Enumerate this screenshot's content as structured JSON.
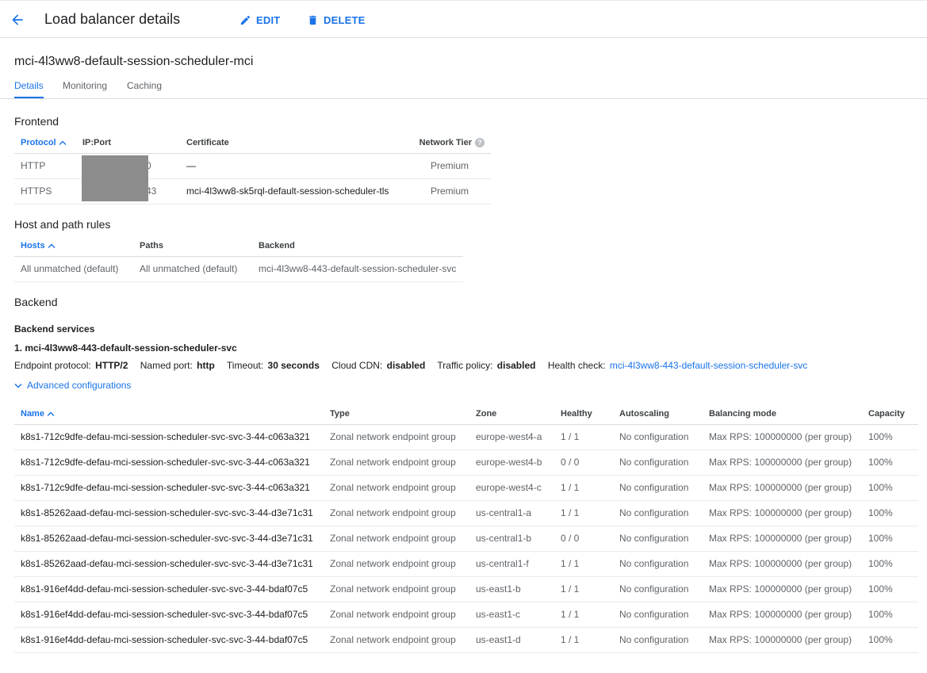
{
  "header": {
    "title": "Load balancer details",
    "edit_label": "EDIT",
    "delete_label": "DELETE",
    "accent": "#1a73e8"
  },
  "lb_name": "mci-4l3ww8-default-session-scheduler-mci",
  "tabs": [
    {
      "label": "Details",
      "active": true
    },
    {
      "label": "Monitoring",
      "active": false
    },
    {
      "label": "Caching",
      "active": false
    }
  ],
  "frontend": {
    "title": "Frontend",
    "headers": {
      "protocol": "Protocol",
      "ipport": "IP:Port",
      "certificate": "Certificate",
      "tier": "Network Tier"
    },
    "rows": [
      {
        "protocol": "HTTP",
        "port": ":80",
        "certificate": "—",
        "tier": "Premium"
      },
      {
        "protocol": "HTTPS",
        "port": ":443",
        "certificate": "mci-4l3ww8-sk5rql-default-session-scheduler-tls",
        "tier": "Premium"
      }
    ]
  },
  "host_rules": {
    "title": "Host and path rules",
    "headers": {
      "hosts": "Hosts",
      "paths": "Paths",
      "backend": "Backend"
    },
    "rows": [
      {
        "hosts": "All unmatched (default)",
        "paths": "All unmatched (default)",
        "backend": "mci-4l3ww8-443-default-session-scheduler-svc"
      }
    ]
  },
  "backend": {
    "title": "Backend",
    "services_title": "Backend services",
    "service_name": "1. mci-4l3ww8-443-default-session-scheduler-svc",
    "endpoint_label": "Endpoint protocol:",
    "endpoint_value": "HTTP/2",
    "port_label": "Named port:",
    "port_value": "http",
    "timeout_label": "Timeout:",
    "timeout_value": "30 seconds",
    "cdn_label": "Cloud CDN:",
    "cdn_value": "disabled",
    "traffic_label": "Traffic policy:",
    "traffic_value": "disabled",
    "health_label": "Health check:",
    "health_value": "mci-4l3ww8-443-default-session-scheduler-svc",
    "advanced_label": "Advanced configurations",
    "headers": {
      "name": "Name",
      "type": "Type",
      "zone": "Zone",
      "healthy": "Healthy",
      "autoscaling": "Autoscaling",
      "mode": "Balancing mode",
      "capacity": "Capacity"
    },
    "rows": [
      {
        "name": "k8s1-712c9dfe-defau-mci-session-scheduler-svc-svc-3-44-c063a321",
        "type": "Zonal network endpoint group",
        "zone": "europe-west4-a",
        "healthy": "1 / 1",
        "autoscaling": "No configuration",
        "mode": "Max RPS: 100000000 (per group)",
        "capacity": "100%"
      },
      {
        "name": "k8s1-712c9dfe-defau-mci-session-scheduler-svc-svc-3-44-c063a321",
        "type": "Zonal network endpoint group",
        "zone": "europe-west4-b",
        "healthy": "0 / 0",
        "autoscaling": "No configuration",
        "mode": "Max RPS: 100000000 (per group)",
        "capacity": "100%"
      },
      {
        "name": "k8s1-712c9dfe-defau-mci-session-scheduler-svc-svc-3-44-c063a321",
        "type": "Zonal network endpoint group",
        "zone": "europe-west4-c",
        "healthy": "1 / 1",
        "autoscaling": "No configuration",
        "mode": "Max RPS: 100000000 (per group)",
        "capacity": "100%"
      },
      {
        "name": "k8s1-85262aad-defau-mci-session-scheduler-svc-svc-3-44-d3e71c31",
        "type": "Zonal network endpoint group",
        "zone": "us-central1-a",
        "healthy": "1 / 1",
        "autoscaling": "No configuration",
        "mode": "Max RPS: 100000000 (per group)",
        "capacity": "100%"
      },
      {
        "name": "k8s1-85262aad-defau-mci-session-scheduler-svc-svc-3-44-d3e71c31",
        "type": "Zonal network endpoint group",
        "zone": "us-central1-b",
        "healthy": "0 / 0",
        "autoscaling": "No configuration",
        "mode": "Max RPS: 100000000 (per group)",
        "capacity": "100%"
      },
      {
        "name": "k8s1-85262aad-defau-mci-session-scheduler-svc-svc-3-44-d3e71c31",
        "type": "Zonal network endpoint group",
        "zone": "us-central1-f",
        "healthy": "1 / 1",
        "autoscaling": "No configuration",
        "mode": "Max RPS: 100000000 (per group)",
        "capacity": "100%"
      },
      {
        "name": "k8s1-916ef4dd-defau-mci-session-scheduler-svc-svc-3-44-bdaf07c5",
        "type": "Zonal network endpoint group",
        "zone": "us-east1-b",
        "healthy": "1 / 1",
        "autoscaling": "No configuration",
        "mode": "Max RPS: 100000000 (per group)",
        "capacity": "100%"
      },
      {
        "name": "k8s1-916ef4dd-defau-mci-session-scheduler-svc-svc-3-44-bdaf07c5",
        "type": "Zonal network endpoint group",
        "zone": "us-east1-c",
        "healthy": "1 / 1",
        "autoscaling": "No configuration",
        "mode": "Max RPS: 100000000 (per group)",
        "capacity": "100%"
      },
      {
        "name": "k8s1-916ef4dd-defau-mci-session-scheduler-svc-svc-3-44-bdaf07c5",
        "type": "Zonal network endpoint group",
        "zone": "us-east1-d",
        "healthy": "1 / 1",
        "autoscaling": "No configuration",
        "mode": "Max RPS: 100000000 (per group)",
        "capacity": "100%"
      }
    ]
  },
  "icons": {
    "back": "arrow-back-icon",
    "edit": "pencil-icon",
    "delete": "trash-icon",
    "sort": "caret-up-icon",
    "help": "help-icon",
    "expand": "chevron-down-icon"
  }
}
